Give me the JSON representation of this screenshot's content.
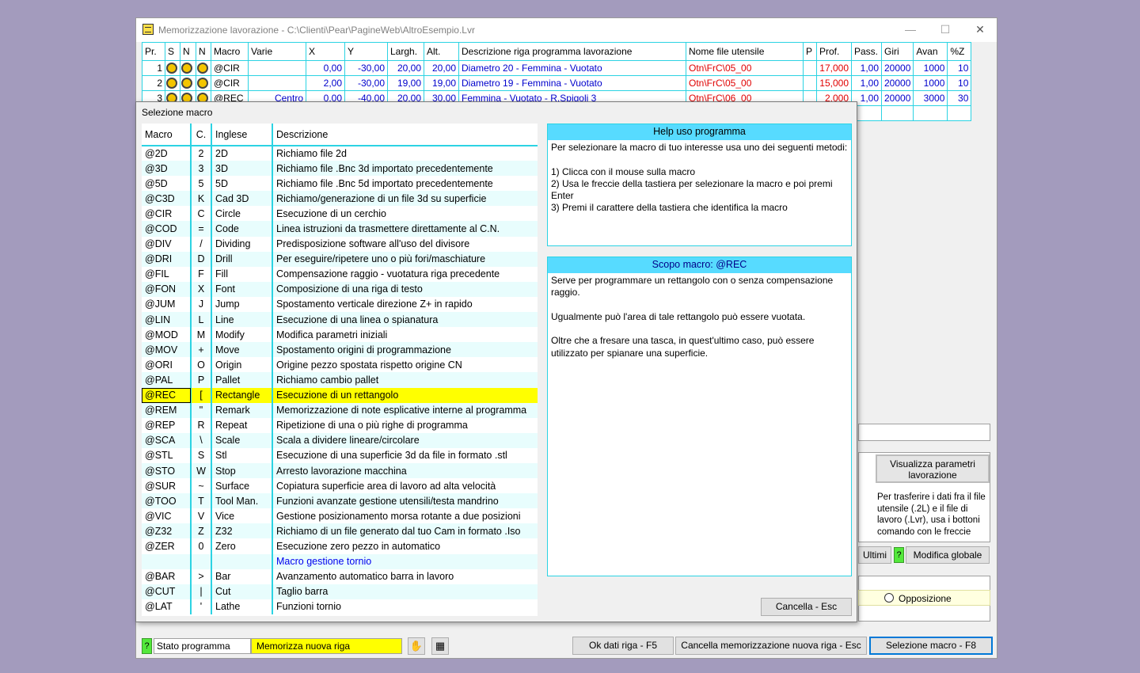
{
  "main_window": {
    "title": "Memorizzazione lavorazione - C:\\Clienti\\Pear\\PagineWeb\\AltroEsempio.Lvr",
    "minimize": "—",
    "maximize": "☐",
    "close": "✕"
  },
  "program_grid": {
    "columns": [
      "Pr.",
      "S",
      "N",
      "N",
      "Macro",
      "Varie",
      "X",
      "Y",
      "Largh.",
      "Alt.",
      "Descrizione riga programma lavorazione",
      "Nome file utensile",
      "P",
      "Prof.",
      "Pass.",
      "Giri",
      "Avan",
      "%Z"
    ],
    "rows": [
      {
        "pr": "1",
        "macro": "@CIR",
        "varie": "",
        "x": "0,00",
        "y": "-30,00",
        "largh": "20,00",
        "alt": "20,00",
        "desc": "Diametro 20 - Femmina - Vuotato",
        "file": "Otn\\FrC\\05_00",
        "p": "",
        "prof": "17,000",
        "pass": "1,00",
        "giri": "20000",
        "avan": "1000",
        "z": "10"
      },
      {
        "pr": "2",
        "macro": "@CIR",
        "varie": "",
        "x": "2,00",
        "y": "-30,00",
        "largh": "19,00",
        "alt": "19,00",
        "desc": "Diametro 19 - Femmina - Vuotato",
        "file": "Otn\\FrC\\05_00",
        "p": "",
        "prof": "15,000",
        "pass": "1,00",
        "giri": "20000",
        "avan": "1000",
        "z": "10"
      },
      {
        "pr": "3",
        "macro": "@REC",
        "varie": "Centro",
        "x": "0,00",
        "y": "-40,00",
        "largh": "20,00",
        "alt": "30,00",
        "desc": "Femmina - Vuotato - R.Spigoli 3",
        "file": "Otn\\FrC\\06_00",
        "p": "",
        "prof": "2,000",
        "pass": "1,00",
        "giri": "20000",
        "avan": "3000",
        "z": "30"
      }
    ]
  },
  "right_panel": {
    "visualizza_label": "Visualizza parametri lavorazione",
    "transfer_text": "Per trasferire i dati fra il file utensile (.2L) e il file di lavoro (.Lvr), usa i bottoni comando con le freccie",
    "ultimi_label": "Ultimi",
    "help_q": "?",
    "modifica_label": "Modifica globale",
    "opposizione_label": "Opposizione"
  },
  "bottom_bar": {
    "help_q": "?",
    "stato_label": "Stato programma",
    "stato_value": "Memorizza nuova riga",
    "ok_label": "Ok dati riga - F5",
    "cancel_label": "Cancella memorizzazione nuova riga - Esc",
    "select_label": "Selezione macro - F8"
  },
  "dialog": {
    "title": "Selezione macro",
    "list_headers": {
      "macro": "Macro",
      "c": "C.",
      "inglese": "Inglese",
      "descrizione": "Descrizione"
    },
    "macros": [
      {
        "macro": "@2D",
        "c": "2",
        "en": "2D",
        "desc": "Richiamo file 2d"
      },
      {
        "macro": "@3D",
        "c": "3",
        "en": "3D",
        "desc": "Richiamo file .Bnc 3d importato precedentemente"
      },
      {
        "macro": "@5D",
        "c": "5",
        "en": "5D",
        "desc": "Richiamo file .Bnc 5d importato precedentemente"
      },
      {
        "macro": "@C3D",
        "c": "K",
        "en": "Cad 3D",
        "desc": "Richiamo/generazione di un file 3d su superficie"
      },
      {
        "macro": "@CIR",
        "c": "C",
        "en": "Circle",
        "desc": "Esecuzione di un cerchio"
      },
      {
        "macro": "@COD",
        "c": "=",
        "en": "Code",
        "desc": "Linea istruzioni da trasmettere direttamente al C.N."
      },
      {
        "macro": "@DIV",
        "c": "/",
        "en": "Dividing",
        "desc": "Predisposizione software all'uso del divisore"
      },
      {
        "macro": "@DRI",
        "c": "D",
        "en": "Drill",
        "desc": "Per eseguire/ripetere uno o più fori/maschiature"
      },
      {
        "macro": "@FIL",
        "c": "F",
        "en": "Fill",
        "desc": "Compensazione raggio - vuotatura riga precedente"
      },
      {
        "macro": "@FON",
        "c": "X",
        "en": "Font",
        "desc": "Composizione di una riga di testo"
      },
      {
        "macro": "@JUM",
        "c": "J",
        "en": "Jump",
        "desc": "Spostamento verticale direzione Z+ in rapido"
      },
      {
        "macro": "@LIN",
        "c": "L",
        "en": "Line",
        "desc": "Esecuzione di una linea o spianatura"
      },
      {
        "macro": "@MOD",
        "c": "M",
        "en": "Modify",
        "desc": "Modifica parametri iniziali"
      },
      {
        "macro": "@MOV",
        "c": "+",
        "en": "Move",
        "desc": "Spostamento origini di programmazione"
      },
      {
        "macro": "@ORI",
        "c": "O",
        "en": "Origin",
        "desc": "Origine pezzo spostata rispetto origine CN"
      },
      {
        "macro": "@PAL",
        "c": "P",
        "en": "Pallet",
        "desc": "Richiamo cambio pallet"
      },
      {
        "macro": "@REC",
        "c": "[",
        "en": "Rectangle",
        "desc": "Esecuzione di un rettangolo"
      },
      {
        "macro": "@REM",
        "c": "\"",
        "en": "Remark",
        "desc": "Memorizzazione di note esplicative interne al programma"
      },
      {
        "macro": "@REP",
        "c": "R",
        "en": "Repeat",
        "desc": "Ripetizione di una o più righe di programma"
      },
      {
        "macro": "@SCA",
        "c": "\\",
        "en": "Scale",
        "desc": "Scala a dividere lineare/circolare"
      },
      {
        "macro": "@STL",
        "c": "S",
        "en": "Stl",
        "desc": "Esecuzione di una superficie 3d da file in formato .stl"
      },
      {
        "macro": "@STO",
        "c": "W",
        "en": "Stop",
        "desc": "Arresto lavorazione macchina"
      },
      {
        "macro": "@SUR",
        "c": "~",
        "en": "Surface",
        "desc": "Copiatura superficie area di lavoro ad alta velocità"
      },
      {
        "macro": "@TOO",
        "c": "T",
        "en": "Tool Man.",
        "desc": "Funzioni avanzate gestione utensili/testa mandrino"
      },
      {
        "macro": "@VIC",
        "c": "V",
        "en": "Vice",
        "desc": "Gestione posizionamento morsa rotante a due posizioni"
      },
      {
        "macro": "@Z32",
        "c": "Z",
        "en": "Z32",
        "desc": "Richiamo di un file generato dal tuo Cam in formato .Iso"
      },
      {
        "macro": "@ZER",
        "c": "0",
        "en": "Zero",
        "desc": "Esecuzione zero pezzo in automatico"
      },
      {
        "macro": "",
        "c": "",
        "en": "",
        "desc": "Macro gestione tornio"
      },
      {
        "macro": "@BAR",
        "c": ">",
        "en": "Bar",
        "desc": "Avanzamento automatico barra in lavoro"
      },
      {
        "macro": "@CUT",
        "c": "|",
        "en": "Cut",
        "desc": "Taglio barra"
      },
      {
        "macro": "@LAT",
        "c": "'",
        "en": "Lathe",
        "desc": "Funzioni tornio"
      }
    ],
    "selected_index": 16,
    "section_index": 27,
    "help_panel": {
      "title": "Help uso programma",
      "text": "Per selezionare la macro di tuo interesse usa uno dei seguenti metodi:\n\n1) Clicca con il mouse sulla macro\n2) Usa le freccie della tastiera per selezionare la macro e poi premi Enter\n3) Premi il carattere della tastiera che identifica la macro"
    },
    "scope_panel": {
      "title": "Scopo macro: @REC",
      "text": "Serve per programmare un rettangolo con o senza compensazione raggio.\n\nUgualmente può l'area di tale rettangolo può essere vuotata.\n\nOltre che a fresare una tasca, in quest'ultimo caso, può essere utilizzato per spianare una superficie."
    },
    "cancel_label": "Cancella - Esc"
  },
  "colors": {
    "desktop": "#a39bbd",
    "grid_border": "#2cd3e3",
    "panel_header": "#57dbff",
    "selection": "#ffff00",
    "help_green": "#53e83b",
    "value_blue": "#0000cc",
    "value_red": "#e00000"
  }
}
